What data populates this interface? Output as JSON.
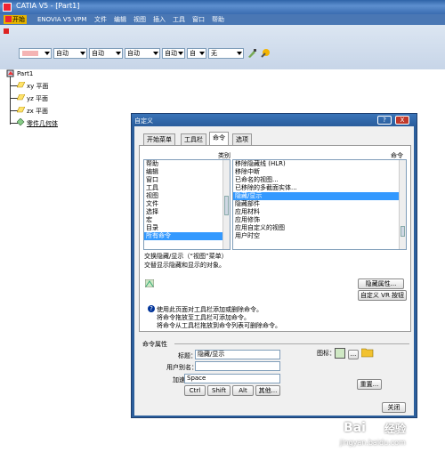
{
  "window": {
    "title": "CATIA V5 - [Part1]"
  },
  "menu": {
    "items": [
      {
        "label": "开始",
        "active": true
      },
      {
        "label": "ENOVIA V5 VPM"
      },
      {
        "label": "文件"
      },
      {
        "label": "编辑"
      },
      {
        "label": "视图"
      },
      {
        "label": "插入"
      },
      {
        "label": "工具"
      },
      {
        "label": "窗口"
      },
      {
        "label": "帮助"
      }
    ]
  },
  "toolbar": {
    "combos": [
      "自动",
      "自动",
      "自动",
      "自动",
      "自",
      "自",
      "无"
    ]
  },
  "tree": {
    "root": "Part1",
    "items": [
      "xy 平面",
      "yz 平面",
      "zx 平面",
      "零件几何体"
    ]
  },
  "dialog": {
    "title": "自定义",
    "help_btn": "?",
    "close_btn": "X",
    "tabs": [
      "开始菜单",
      "工具栏",
      "命令",
      "选项"
    ],
    "categories_header": "类别",
    "commands_header": "命令",
    "categories": [
      "帮助",
      "编辑",
      "窗口",
      "工具",
      "视图",
      "文件",
      "选择",
      "宏",
      "目录",
      "所有命令"
    ],
    "selected_category_index": 9,
    "commands": [
      "移除隐藏线 (HLR)",
      "移除中断",
      "已命名的视图...",
      "已移除的多截面实体...",
      "隐藏/显示",
      "隐藏部件",
      "应用材料",
      "应用修饰",
      "应用自定义的视图",
      "用户时空"
    ],
    "selected_command_index": 4,
    "desc_line1": "交换隐藏/显示（“视图”菜单）",
    "desc_line2": "交替显示隐藏和显示的对象。",
    "btn_hide_props": "隐藏属性...",
    "btn_vr": "自定义 VR 按钮",
    "hint1": "使用此页面对工具栏添加或删除命令。",
    "hint2": "将命令拖放至工具栏可添加命令。",
    "hint3": "将命令从工具栏拖放到命令列表可删除命令。",
    "props_header": "命令属性",
    "label_title": "标题：",
    "value_title": "隐藏/显示",
    "label_alias": "用户别名：",
    "value_alias": "",
    "label_icon": "图标：",
    "label_accel": "加速器：",
    "value_accel": "Space",
    "key_ctrl": "Ctrl",
    "key_shift": "Shift",
    "key_alt": "Alt",
    "key_other": "其他...",
    "btn_reset": "重置...",
    "btn_close": "关闭",
    "icon_more": "..."
  },
  "watermark": {
    "brand": "Bai",
    "brand2": "经验",
    "url": "jingyan.baidu.com"
  }
}
